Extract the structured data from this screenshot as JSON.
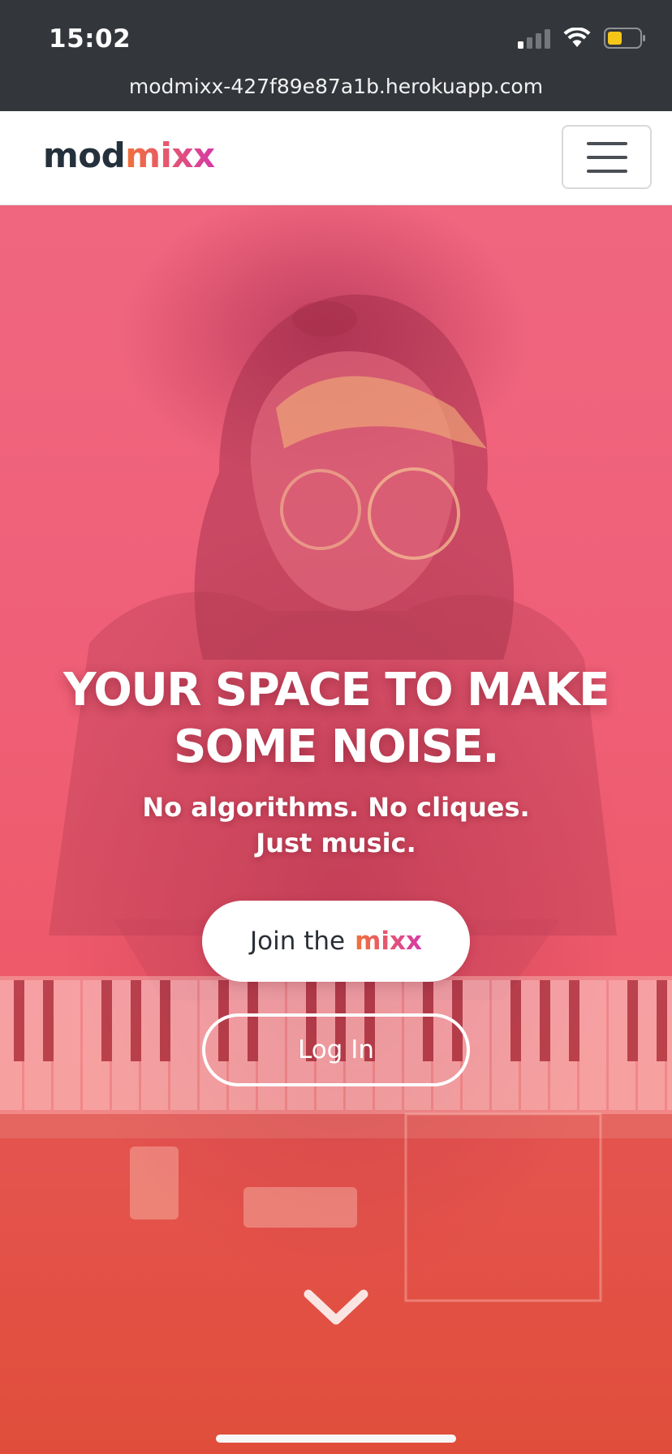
{
  "status_bar": {
    "time": "15:02",
    "signal_icon": "cellular-signal-icon",
    "wifi_icon": "wifi-icon",
    "battery_icon": "battery-low-icon",
    "battery_color": "#f5c518"
  },
  "browser": {
    "url": "modmixx-427f89e87a1b.herokuapp.com"
  },
  "navbar": {
    "brand_part1": "mod",
    "brand_part2": "mixx",
    "menu_icon": "hamburger-menu-icon"
  },
  "hero": {
    "headline_line1": "YOUR SPACE TO MAKE",
    "headline_line2": "SOME NOISE.",
    "subline_line1": "No algorithms. No cliques.",
    "subline_line2": "Just music.",
    "join_prefix": "Join the",
    "join_accent": "mixx",
    "login_label": "Log In",
    "scroll_icon": "chevron-down-icon"
  },
  "colors": {
    "brand_dark": "#24313c",
    "brand_gradient_start": "#f2713a",
    "brand_gradient_end": "#d63aa8",
    "hero_overlay": "#ef6078",
    "chrome_dark": "#33363b"
  }
}
